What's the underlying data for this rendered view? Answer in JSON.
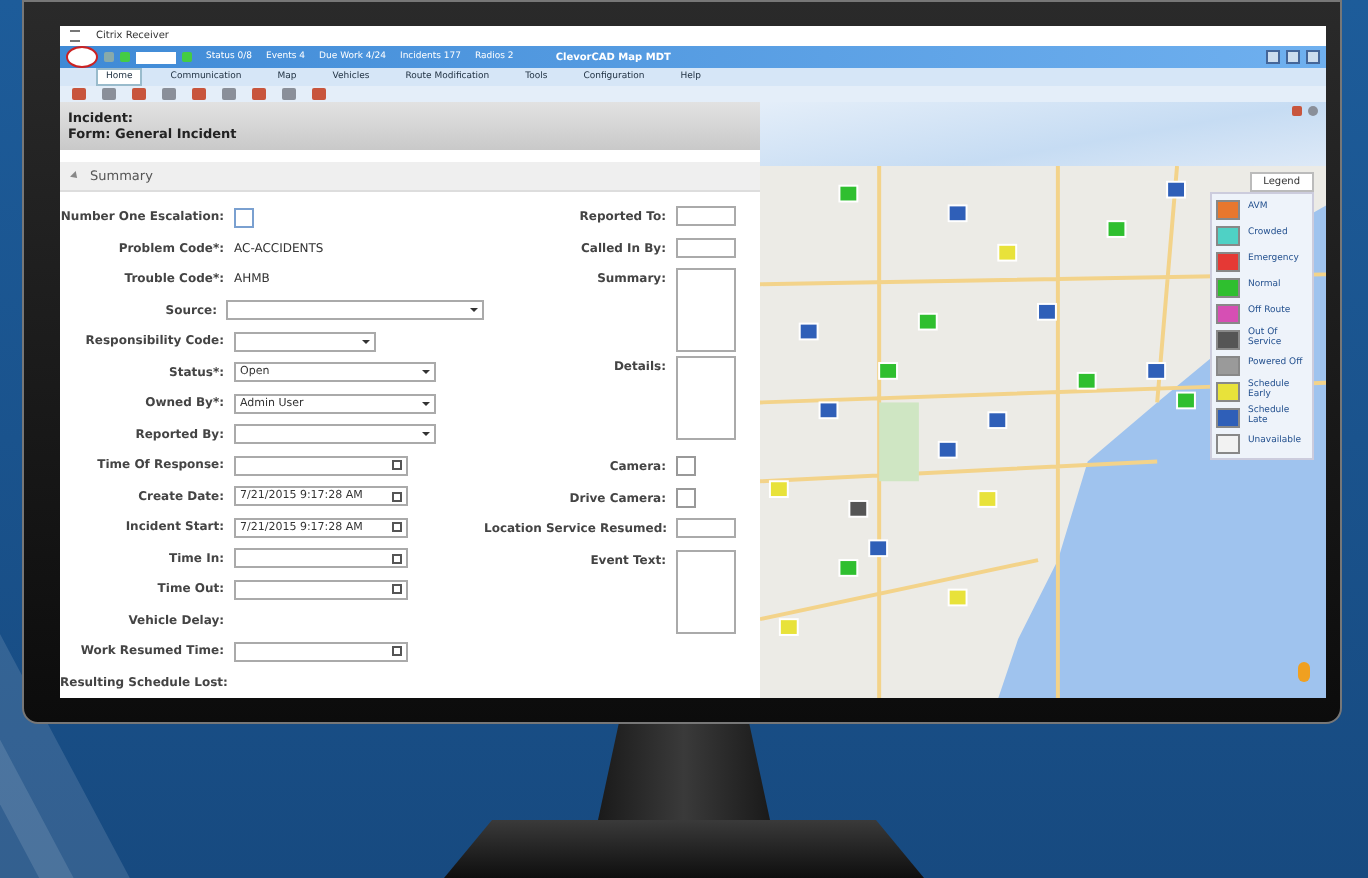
{
  "window": {
    "title": "Citrix Receiver"
  },
  "app_bar": {
    "status_items": [
      "Status 0/8",
      "Events 4",
      "Due Work 4/24",
      "Incidents 177",
      "Radios 2"
    ],
    "title": "ClevorCAD Map MDT"
  },
  "ribbon_tabs": [
    {
      "label": "Home",
      "selected": true
    },
    {
      "label": "Communication",
      "selected": false
    },
    {
      "label": "Map",
      "selected": false
    },
    {
      "label": "Vehicles",
      "selected": false
    },
    {
      "label": "Route Modification",
      "selected": false
    },
    {
      "label": "Tools",
      "selected": false
    },
    {
      "label": "Configuration",
      "selected": false
    },
    {
      "label": "Help",
      "selected": false
    }
  ],
  "form": {
    "header_lines": [
      "Incident:",
      "Form: General Incident"
    ],
    "section": {
      "label": "Summary",
      "expanded": true
    },
    "left_fields": [
      {
        "label": "Number One Escalation:",
        "kind": "checkbox",
        "checked": false
      },
      {
        "label": "Problem Code*:",
        "kind": "static",
        "value": "AC-ACCIDENTS"
      },
      {
        "label": "Trouble Code*:",
        "kind": "static",
        "value": "AHMB"
      },
      {
        "label": "Source:",
        "kind": "select-long"
      },
      {
        "label": "Responsibility Code:",
        "kind": "select-short"
      },
      {
        "label": "Status*:",
        "kind": "select",
        "value": "Open"
      },
      {
        "label": "Owned By*:",
        "kind": "select",
        "value": "Admin User"
      },
      {
        "label": "Reported By:",
        "kind": "select"
      },
      {
        "label": "Time Of Response:",
        "kind": "date"
      },
      {
        "label": "Create Date:",
        "kind": "date",
        "value": "7/21/2015 9:17:28 AM"
      },
      {
        "label": "Incident Start:",
        "kind": "date",
        "value": "7/21/2015 9:17:28 AM"
      },
      {
        "label": "Time In:",
        "kind": "date"
      },
      {
        "label": "Time Out:",
        "kind": "date"
      },
      {
        "label": "Vehicle Delay:",
        "kind": "static"
      },
      {
        "label": "Work Resumed Time:",
        "kind": "date"
      },
      {
        "label": "Resulting Schedule Lost:",
        "kind": "static"
      }
    ],
    "right_fields": [
      {
        "label": "Reported To:",
        "kind": "text"
      },
      {
        "label": "Called In By:",
        "kind": "text"
      },
      {
        "label": "Summary:",
        "kind": "textarea-short"
      },
      {
        "label": "Details:",
        "kind": "textarea"
      },
      {
        "label": "Camera:",
        "kind": "checkbox",
        "checked": false
      },
      {
        "label": "Drive Camera:",
        "kind": "checkbox",
        "checked": false
      },
      {
        "label": "Location Service Resumed:",
        "kind": "text"
      },
      {
        "label": "Event Text:",
        "kind": "textarea"
      }
    ]
  },
  "map": {
    "legend": {
      "title": "Legend",
      "items": [
        {
          "label": "AVM",
          "color": "#e8772e"
        },
        {
          "label": "Crowded",
          "color": "#4fd1c5"
        },
        {
          "label": "Emergency",
          "color": "#e53935"
        },
        {
          "label": "Normal",
          "color": "#2fbf2f"
        },
        {
          "label": "Off Route",
          "color": "#d64fb4"
        },
        {
          "label": "Out Of Service",
          "color": "#555555"
        },
        {
          "label": "Powered Off",
          "color": "#9a9a9a"
        },
        {
          "label": "Schedule Early",
          "color": "#e8e23a"
        },
        {
          "label": "Schedule Late",
          "color": "#2f5fb8"
        },
        {
          "label": "Unavailable",
          "color": "#f2f2f2"
        }
      ]
    }
  }
}
